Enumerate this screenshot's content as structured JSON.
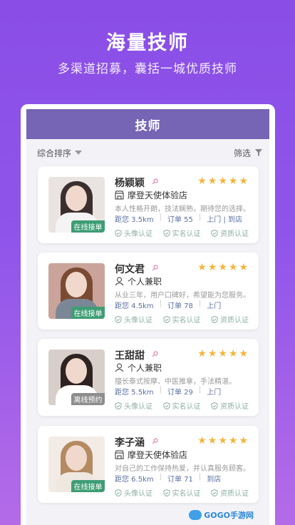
{
  "hero": {
    "title": "海量技师",
    "subtitle": "多渠道招募，囊括一城优质技师"
  },
  "header": {
    "title": "技师"
  },
  "filter": {
    "sort_label": "综合排序",
    "filter_label": "筛选"
  },
  "cert_labels": [
    "头像认证",
    "实名认证",
    "资质认证"
  ],
  "rating_stars": 5,
  "technicians": [
    {
      "name": "杨颖颖",
      "type_icon": "store-icon",
      "type": "摩登天使体验店",
      "desc": "本人性格开朗，技法娴熟，期待您的选择。",
      "distance": "距您 3.5km",
      "orders": "订单 55",
      "service": "上门 | 到店",
      "status": "在线接单",
      "status_color": "#3f9d74",
      "hair_color": "#3a2f2e",
      "body_color": "#f4f4f4",
      "bg_color": "#e9e4e1"
    },
    {
      "name": "何文君",
      "type_icon": "person-icon",
      "type": "个人兼职",
      "desc": "从业三年，用户口碑好，希望能为您服务。",
      "distance": "距您 4.5km",
      "orders": "订单 78",
      "service": "上门",
      "status": "在线接单",
      "status_color": "#3f9d74",
      "hair_color": "#7a4b33",
      "body_color": "#7b8796",
      "bg_color": "#caa49a"
    },
    {
      "name": "王甜甜",
      "type_icon": "person-icon",
      "type": "个人兼职",
      "desc": "擅长泰式按摩、中医推拿，手法精湛。",
      "distance": "距您 5.5km",
      "orders": "订单 29",
      "service": "上门",
      "status": "离线预约",
      "status_color": "#8d8d8d",
      "hair_color": "#2e2321",
      "body_color": "#ffffff",
      "bg_color": "#d8cfca"
    },
    {
      "name": "李子涵",
      "type_icon": "store-icon",
      "type": "摩登天使体验店",
      "desc": "对自己的工作保持热爱，并认真服务顾客。",
      "distance": "距您 6.5km",
      "orders": "订单 71",
      "service": "到店",
      "status": "在线接单",
      "status_color": "#3f9d74",
      "hair_color": "#b48a62",
      "body_color": "#efe8e0",
      "bg_color": "#f3ece6"
    }
  ],
  "watermark": "GOGO手游网"
}
